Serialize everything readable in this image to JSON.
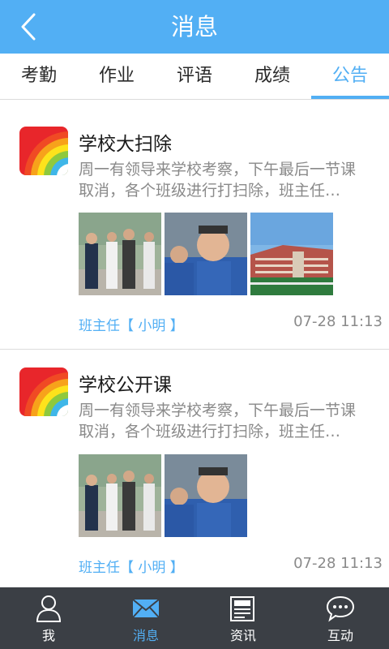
{
  "header": {
    "title": "消息",
    "back_icon": "chevron-left-icon"
  },
  "tabs": [
    {
      "label": "考勤",
      "active": false
    },
    {
      "label": "作业",
      "active": false
    },
    {
      "label": "评语",
      "active": false
    },
    {
      "label": "成绩",
      "active": false
    },
    {
      "label": "公告",
      "active": true
    }
  ],
  "announcements": [
    {
      "title": "学校大扫除",
      "desc_line1": "周一有领导来学校考察，下午最后一节课",
      "desc_line2": "取消，各个班级进行打扫除，班主任…",
      "author": "班主任【 小明 】",
      "time": "07-28 11:13",
      "photos": [
        "officials-walking-photo",
        "officials-smiling-photo",
        "school-building-photo"
      ]
    },
    {
      "title": "学校公开课",
      "desc_line1": "周一有领导来学校考察，下午最后一节课",
      "desc_line2": "取消，各个班级进行打扫除，班主任…",
      "author": "班主任【 小明 】",
      "time": "07-28 11:13",
      "photos": [
        "officials-walking-photo",
        "officials-smiling-photo"
      ]
    }
  ],
  "bottom_nav": [
    {
      "label": "我",
      "icon": "person-icon",
      "active": false
    },
    {
      "label": "消息",
      "icon": "envelope-icon",
      "active": true
    },
    {
      "label": "资讯",
      "icon": "newspaper-icon",
      "active": false
    },
    {
      "label": "互动",
      "icon": "chat-bubble-icon",
      "active": false
    }
  ],
  "colors": {
    "accent": "#52aff4",
    "bottom_bar": "#3b3f45",
    "divider": "#dcdcdc"
  }
}
